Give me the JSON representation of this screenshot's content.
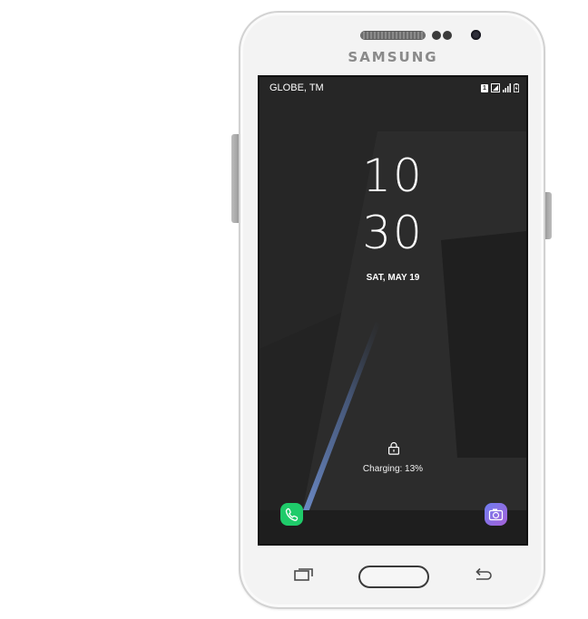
{
  "device": {
    "brand": "SAMSUNG"
  },
  "status_bar": {
    "carrier": "GLOBE, TM",
    "sim_badge": "1",
    "icons": [
      "sim-1-icon",
      "signal-sim1-icon",
      "signal-sim2-icon",
      "battery-charging-icon"
    ]
  },
  "lock_screen": {
    "clock_hour": "10",
    "clock_minute": "30",
    "date": "SAT, MAY 19",
    "charging_status": "Charging: 13%",
    "shortcuts": {
      "left": "phone-icon",
      "right": "camera-icon"
    }
  },
  "hardware_keys": {
    "left": "recent-apps-icon",
    "center": "home-button",
    "right": "back-icon"
  },
  "colors": {
    "screen_bg": "#262626",
    "phone_shortcut": "#1fcb6a",
    "camera_shortcut_start": "#6f7df0",
    "camera_shortcut_end": "#a561d8",
    "phone_body": "#f3f3f3"
  }
}
